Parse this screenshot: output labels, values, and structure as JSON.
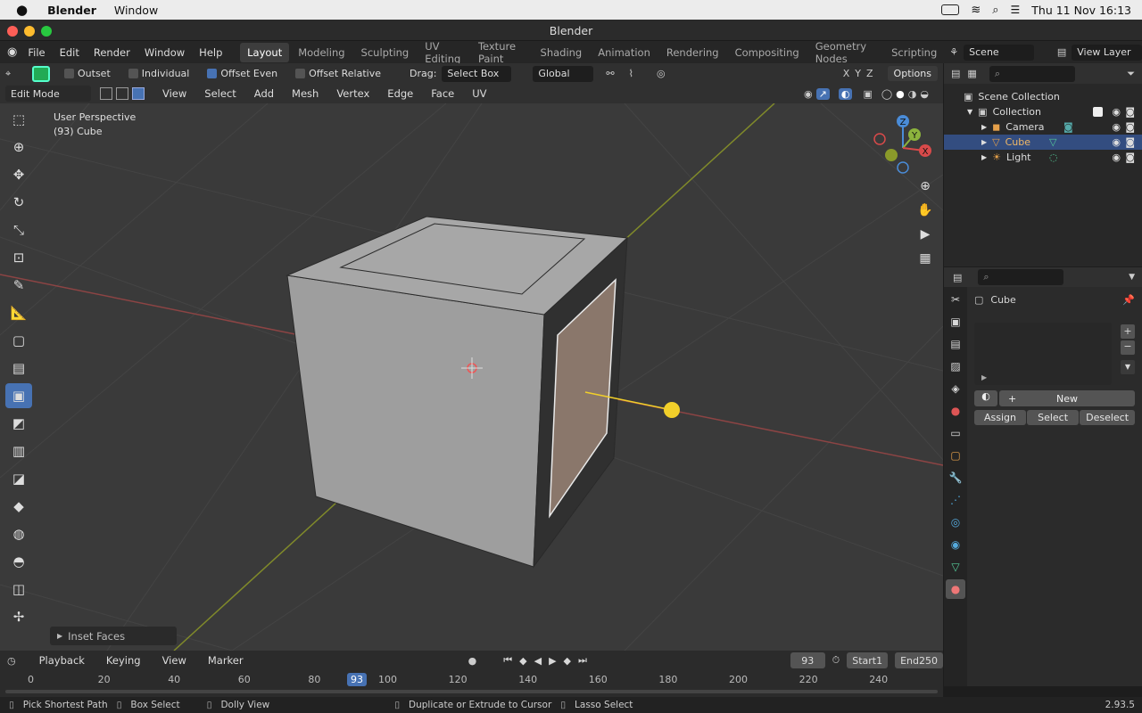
{
  "macos_menu": {
    "app": "Blender",
    "window_menu": "Window",
    "datetime": "Thu 11 Nov  16:13"
  },
  "window": {
    "title": "Blender"
  },
  "menus": [
    "File",
    "Edit",
    "Render",
    "Window",
    "Help"
  ],
  "workspaces": [
    "Layout",
    "Modeling",
    "Sculpting",
    "UV Editing",
    "Texture Paint",
    "Shading",
    "Animation",
    "Rendering",
    "Compositing",
    "Geometry Nodes",
    "Scripting"
  ],
  "active_workspace": "Layout",
  "scene": {
    "name": "Scene",
    "view_layer": "View Layer"
  },
  "tool_header": {
    "outset": "Outset",
    "individual": "Individual",
    "offset_even": "Offset Even",
    "offset_relative": "Offset Relative",
    "drag_label": "Drag:",
    "drag_value": "Select Box",
    "orientation": "Global",
    "options": "Options",
    "axes": [
      "X",
      "Y",
      "Z"
    ]
  },
  "mode_header": {
    "mode": "Edit Mode",
    "menus": [
      "View",
      "Select",
      "Add",
      "Mesh",
      "Vertex",
      "Edge",
      "Face",
      "UV"
    ]
  },
  "viewport": {
    "perspective": "User Perspective",
    "object_info": "(93) Cube",
    "last_op": "Inset Faces",
    "gizmo_axes": [
      "X",
      "Y",
      "Z"
    ]
  },
  "outliner": {
    "root": "Scene Collection",
    "collection": "Collection",
    "items": [
      {
        "name": "Camera"
      },
      {
        "name": "Cube"
      },
      {
        "name": "Light"
      }
    ]
  },
  "properties": {
    "object_name": "Cube",
    "new": "New",
    "assign": "Assign",
    "select": "Select",
    "deselect": "Deselect"
  },
  "timeline": {
    "menus": [
      "Playback",
      "Keying",
      "View",
      "Marker"
    ],
    "current_frame": "93",
    "start_label": "Start",
    "start": "1",
    "end_label": "End",
    "end": "250",
    "ruler": [
      "0",
      "20",
      "40",
      "60",
      "80",
      "100",
      "120",
      "140",
      "160",
      "180",
      "200",
      "220",
      "240"
    ]
  },
  "statusbar": {
    "item1": "Pick Shortest Path",
    "item2": "Box Select",
    "item3": "Dolly View",
    "item4": "Duplicate or Extrude to Cursor",
    "item5": "Lasso Select",
    "version": "2.93.5"
  },
  "colors": {
    "accent": "#4772b3",
    "selected_face": "#8a776b",
    "light": "#f1cf2a",
    "x_axis": "#b84a4a",
    "y_axis": "#8a9a2a"
  }
}
